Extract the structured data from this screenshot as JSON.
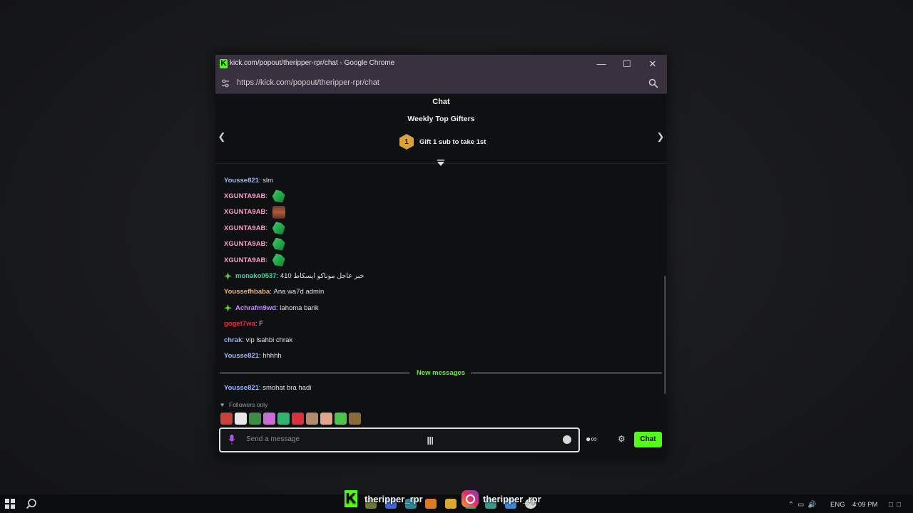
{
  "window": {
    "title": "kick.com/popout/theripper-rpr/chat - Google Chrome",
    "url": "https://kick.com/popout/theripper-rpr/chat"
  },
  "chat": {
    "header": "Chat",
    "top_gifters": {
      "title": "Weekly Top Gifters",
      "rank": "1",
      "cta": "Gift 1 sub to take 1st"
    },
    "messages": [
      {
        "user": "Yousse821",
        "text": "slm",
        "color": "#9ab8ff"
      },
      {
        "user": "XGUNTA9AB",
        "text": "",
        "color": "#f5a0c8",
        "emote": "green-emote"
      },
      {
        "user": "XGUNTA9AB",
        "text": "",
        "color": "#f5a0c8",
        "emote": "face-emote"
      },
      {
        "user": "XGUNTA9AB",
        "text": "",
        "color": "#f5a0c8",
        "emote": "green-emote"
      },
      {
        "user": "XGUNTA9AB",
        "text": "",
        "color": "#f5a0c8",
        "emote": "green-emote"
      },
      {
        "user": "XGUNTA9AB",
        "text": "",
        "color": "#f5a0c8",
        "emote": "green-emote"
      },
      {
        "user": "monako0537",
        "text": "خبر عاجل موناكو ايسكاط 410",
        "color": "#3fd6a0",
        "badge": "star-badge"
      },
      {
        "user": "Youssefhbaba",
        "text": "Ana wa7d admin",
        "color": "#f0b26b"
      },
      {
        "user": "Achrafm9wd",
        "text": "lahoma barik",
        "color": "#c58cf5",
        "badge": "star-badge"
      },
      {
        "user": "goget7wa",
        "text": "F",
        "color": "#e0304a"
      },
      {
        "user": "chrak",
        "text": "vip lsahbi chrak",
        "color": "#8ab4ff"
      },
      {
        "user": "Yousse821",
        "text": "hhhhh",
        "color": "#9ab8ff"
      }
    ],
    "new_messages_label": "New messages",
    "after_messages": [
      {
        "user": "Yousse821",
        "text": "smohat bra hadi",
        "color": "#9ab8ff"
      }
    ],
    "followers_only": "Followers only",
    "input_placeholder": "Send a message",
    "send_label": "Chat",
    "accent": "#53fc18"
  },
  "taskbar": {
    "kick_handle": "theripper_rpr",
    "instagram_handle": "theripper_rpr",
    "language": "ENG",
    "time": "4:09 PM"
  }
}
